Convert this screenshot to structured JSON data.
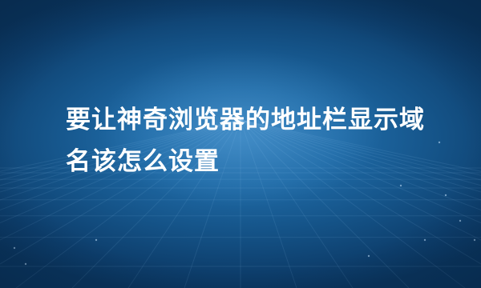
{
  "banner": {
    "title": "要让神奇浏览器的地址栏显示域名该怎么设置",
    "background_colors": {
      "center": "#2f7bb8",
      "edge": "#0a355e"
    },
    "text_color": "#ffffff"
  }
}
